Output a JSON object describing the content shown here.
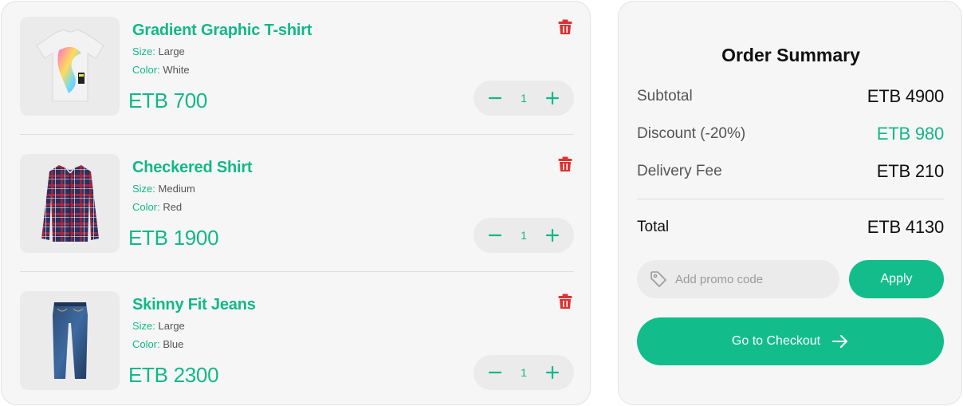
{
  "colors": {
    "accent": "#12b886",
    "danger": "#e03131",
    "panel": "#f6f6f6"
  },
  "cart": {
    "items": [
      {
        "name": "Gradient Graphic T-shirt",
        "size_label": "Size:",
        "size": "Large",
        "color_label": "Color:",
        "color": "White",
        "price": "ETB 700",
        "quantity": "1",
        "image_icon": "tshirt-icon"
      },
      {
        "name": "Checkered Shirt",
        "size_label": "Size:",
        "size": "Medium",
        "color_label": "Color:",
        "color": "Red",
        "price": "ETB 1900",
        "quantity": "1",
        "image_icon": "shirt-icon"
      },
      {
        "name": "Skinny Fit Jeans",
        "size_label": "Size:",
        "size": "Large",
        "color_label": "Color:",
        "color": "Blue",
        "price": "ETB 2300",
        "quantity": "1",
        "image_icon": "jeans-icon"
      }
    ]
  },
  "summary": {
    "title": "Order Summary",
    "subtotal_label": "Subtotal",
    "subtotal_value": "ETB 4900",
    "discount_label": "Discount (-20%)",
    "discount_value": "ETB 980",
    "delivery_label": "Delivery Fee",
    "delivery_value": "ETB 210",
    "total_label": "Total",
    "total_value": "ETB 4130",
    "promo_placeholder": "Add promo code",
    "apply_label": "Apply",
    "checkout_label": "Go to Checkout"
  }
}
